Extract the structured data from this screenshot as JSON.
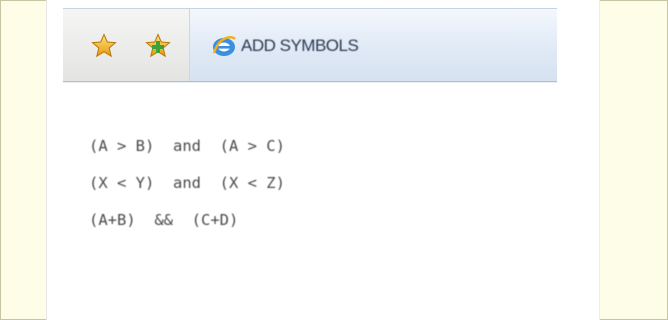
{
  "toolbar": {
    "icons": [
      "favorites-star-icon",
      "add-favorite-star-icon",
      "ie-logo-icon"
    ],
    "add_symbols_label": "ADD SYMBOLS"
  },
  "editor": {
    "lines": [
      "(A > B)  and  (A > C)",
      "(X < Y)  and  (X < Z)",
      "(A+B)  &&  (C+D)"
    ]
  },
  "colors": {
    "page_background": "#fdfbe0",
    "toolbar_gradient_top": "#f4f8fd",
    "toolbar_gradient_bottom": "#d6e2f1",
    "star": "#f2b01e",
    "add_star_plus": "#3aa33a",
    "text": "#4a4a4a"
  }
}
